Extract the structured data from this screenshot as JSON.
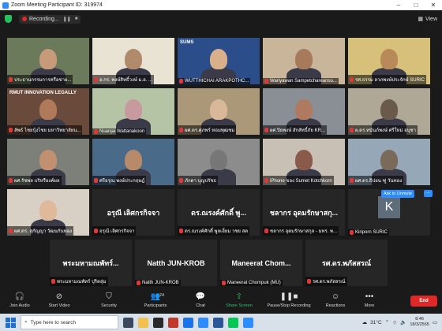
{
  "window": {
    "title": "Zoom Meeting Participant ID: 319974"
  },
  "topbar": {
    "recording_label": "Recording...",
    "view_label": "View"
  },
  "tiles": [
    {
      "name": "ประธานกรรมการครือข่าย...",
      "speaking": false
    },
    {
      "name": "อ.กร. พงษ์สิทธิ์วงษ์ ม.อ. ...",
      "speaking": false
    },
    {
      "name": "WUTTHICHAI ARAKPOTHC...",
      "speaking": true,
      "logo": "SUMS"
    },
    {
      "name": "Wariyawan Sampetchareansu...",
      "speaking": false
    },
    {
      "name": "รศ.ธรรม ลาภพงษ์ประจักษ์ SURIC",
      "speaking": false
    },
    {
      "name": "ลัพธ์ ไชยบุ้งไชย มหาวิทยาลัยน...",
      "speaking": false,
      "logo": "RMUT INNOVATION LEGALLY"
    },
    {
      "name": "Nuanjai Wattanakoon",
      "speaking": false
    },
    {
      "name": "ผศ.ดร.ศุภพร์ หอมพุฒชม",
      "speaking": false
    },
    {
      "name": "ผศ.ปิยพงษ์ สักสัทธิ์ภัย KR...",
      "speaking": false
    },
    {
      "name": "ผ.ดร.ทนันภ์พงษ์ ศรีใหม่ อบุชา",
      "speaking": false
    },
    {
      "name": "ผศ.รัชพล บริหรืองค์ผล",
      "speaking": false
    },
    {
      "name": "ศรีอรุณ พงษ์ประกฤษฎ์",
      "speaking": false
    },
    {
      "name": "ภักดา บุญปรัชธ",
      "speaking": false
    },
    {
      "name": "iPhone ของ Sumet Kotchkorn",
      "speaking": false
    },
    {
      "name": "ผศ.ดร.ธิปยน ฑู่ วันทอง",
      "speaking": false
    },
    {
      "name": "ผศ.ดร. สุกัญญา วัฒนกันทอง",
      "speaking": false
    },
    {
      "name": "อรุณี เลิศกรกิจจา",
      "speaking": false,
      "big": "อรุณี เลิศกรกิจจา"
    },
    {
      "name": "ดร.ณรงค์ศักดิ์ พูลเอี่ยม วชย สต",
      "speaking": false,
      "big": "ดร.ณรงค์ศักดิ์ พู..."
    },
    {
      "name": "ชลากร อุดมรักษาสกุล - มทร. พ...",
      "speaking": false,
      "big": "ชลากร อุดมรักษาสกุ..."
    },
    {
      "name": "Kiriporn SURIC",
      "speaking": false,
      "avatar": "K"
    },
    {
      "name": "พระมหามณพัทร์ ปุริตลุ่ม",
      "speaking": false,
      "big": "พระมหามณพัทร์..."
    },
    {
      "name": "Natth JUN-KROB",
      "speaking": false,
      "big": "Natth JUN-KROB"
    },
    {
      "name": "Maneerat Chompuk (MU)",
      "speaking": false,
      "big": "Maneerat Chom..."
    },
    {
      "name": "รศ.ดร.พภัสสรณ์",
      "speaking": false,
      "big": "รศ.ดร.พภัสสรณ์"
    }
  ],
  "overlay": {
    "ask_unmute": "Ask to Unmute",
    "more": "..."
  },
  "toolbar": {
    "join_audio": "Join Audio",
    "start_video": "Start Video",
    "security": "Security",
    "participants": "Participants",
    "participants_count": "24",
    "chat": "Chat",
    "share_screen": "Share Screen",
    "pause_recording": "Pause/Stop Recording",
    "reactions": "Reactions",
    "more": "More",
    "end": "End"
  },
  "taskbar": {
    "search_placeholder": "Type here to search",
    "weather": "31°C",
    "time": "8:46",
    "date": "18/3/2565"
  },
  "colors": {
    "accent": "#2d8cff",
    "speaking": "#7ed321",
    "end": "#e02828",
    "share": "#33c25f"
  }
}
